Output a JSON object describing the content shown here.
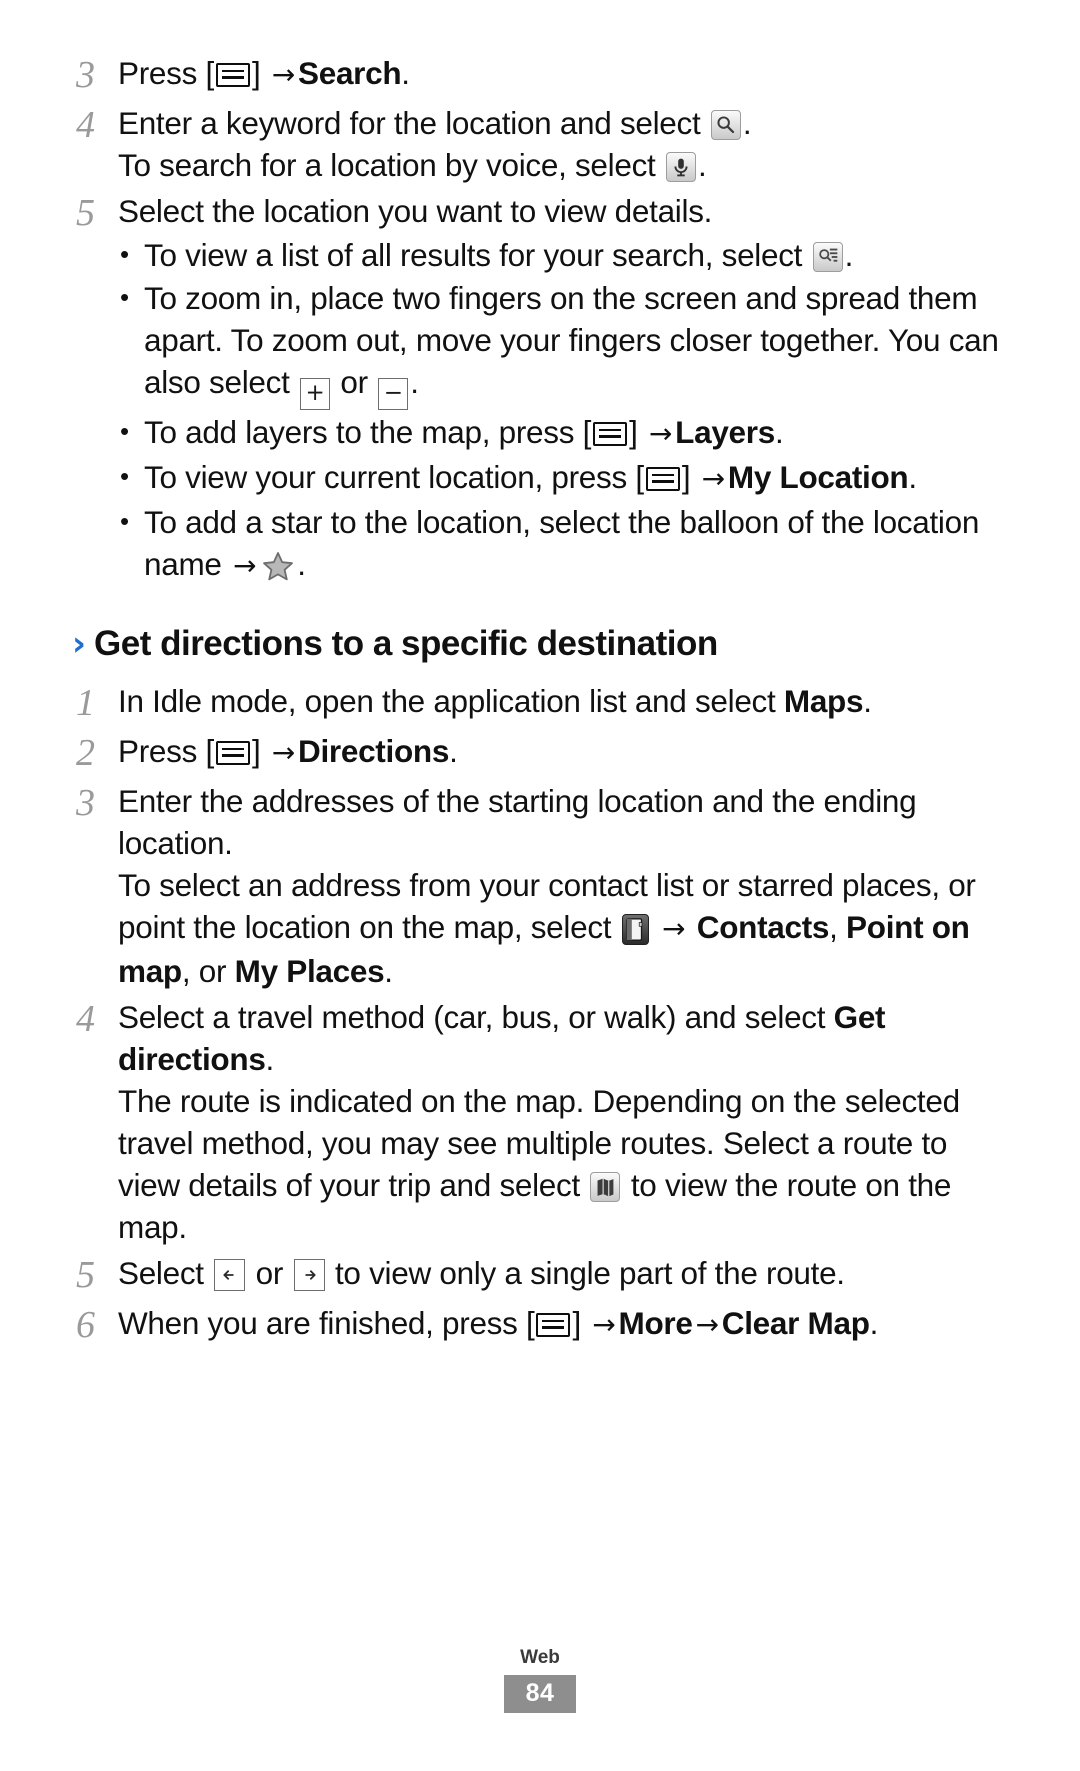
{
  "document": {
    "footer": {
      "section_label": "Web",
      "page_number": "84"
    }
  },
  "steps_maps_search": [
    {
      "number": "3",
      "parts": [
        {
          "type": "text",
          "value": "Press ["
        },
        {
          "type": "icon",
          "name": "menu-key-icon"
        },
        {
          "type": "text",
          "value": "] "
        },
        {
          "type": "arrow",
          "value": "→"
        },
        {
          "type": "bold",
          "value": " Search"
        },
        {
          "type": "text",
          "value": "."
        }
      ],
      "line1": "Press [",
      "line1_after": "] ",
      "bold": "Search",
      "end": "."
    },
    {
      "number": "4",
      "line1a": "Enter a keyword for the location and select ",
      "line1b": ".",
      "line2a": "To search for a location by voice, select ",
      "line2b": "."
    },
    {
      "number": "5",
      "line1": "Select the location you want to view details."
    }
  ],
  "bullets": {
    "b1a": "To view a list of all results for your search, select ",
    "b1b": ".",
    "b2a": "To zoom in, place two fingers on the screen and spread them apart. To zoom out, move your fingers closer together. You can also select ",
    "b2_or": " or ",
    "b2b": ".",
    "b3a": "To add layers to the map, press [",
    "b3b": "] ",
    "b3_bold": "Layers",
    "b3c": ".",
    "b4a": "To view your current location, press [",
    "b4b": "] ",
    "b4_bold": "My Location",
    "b4c": ".",
    "b5a": "To add a star to the location, select the balloon of the location name ",
    "b5b": "."
  },
  "section": {
    "chevron": "›",
    "title": "Get directions to a specific destination"
  },
  "steps_directions": {
    "s1": {
      "number": "1",
      "text_a": "In Idle mode, open the application list and select ",
      "bold": "Maps",
      "text_b": "."
    },
    "s2": {
      "number": "2",
      "text_a": "Press [",
      "text_b": "] ",
      "bold": "Directions",
      "text_c": "."
    },
    "s3": {
      "number": "3",
      "para1": "Enter the addresses of the starting location and the ending location.",
      "para2_a": "To select an address from your contact list or starred places, or point the location on the map, select ",
      "para2_b": " ",
      "bold1": "Contacts",
      "sep1": ", ",
      "bold2": "Point on map",
      "sep2": ", or ",
      "bold3": "My Places",
      "end": "."
    },
    "s4": {
      "number": "4",
      "para1_a": "Select a travel method (car, bus, or walk) and select ",
      "bold": "Get directions",
      "para1_b": ".",
      "para2_a": "The route is indicated on the map. Depending on the selected travel method, you may see multiple routes. Select a route to view details of your trip and select ",
      "para2_b": " to view the route on the map."
    },
    "s5": {
      "number": "5",
      "text_a": "Select ",
      "text_or": " or ",
      "text_b": " to view only a single part of the route."
    },
    "s6": {
      "number": "6",
      "text_a": "When you are finished, press [",
      "text_b": "] ",
      "bold1": "More",
      "bold2": "Clear Map",
      "end": "."
    }
  },
  "icons": {
    "menu_key": "menu-key-icon",
    "search": "search-magnifier-icon",
    "voice": "microphone-icon",
    "list_results": "search-results-list-icon",
    "zoom_in": "zoom-in-plus-icon",
    "zoom_out": "zoom-out-minus-icon",
    "star": "star-icon",
    "contacts_book": "contacts-book-icon",
    "map_view": "map-view-icon",
    "prev_step": "previous-step-arrow-icon",
    "next_step": "next-step-arrow-icon"
  },
  "colors": {
    "heading_chevron": "#1f6fd0",
    "step_number": "#9a9a9a",
    "footer_badge": "#8e8e8e",
    "text": "#111111"
  }
}
